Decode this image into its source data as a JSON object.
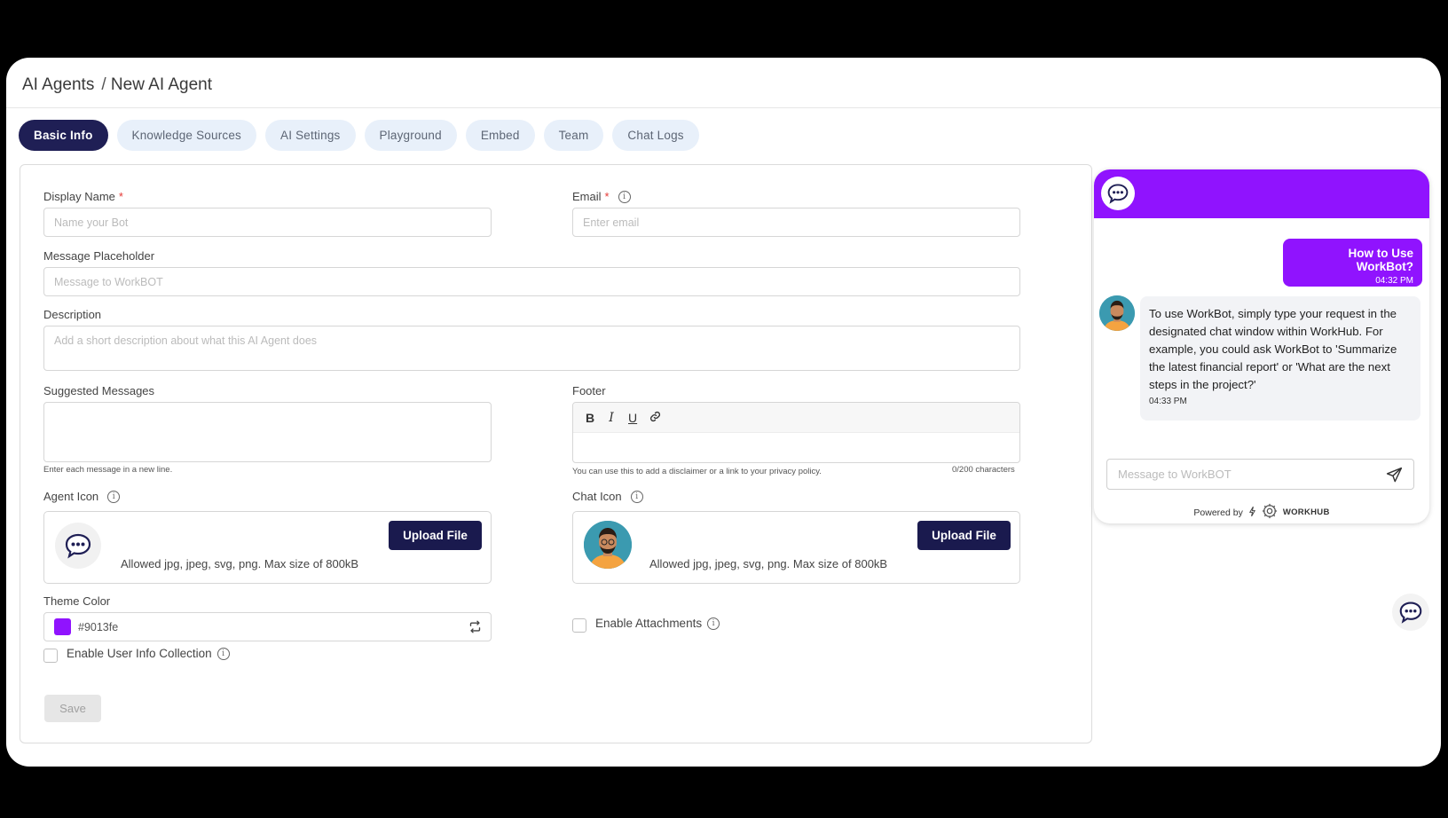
{
  "breadcrumb": {
    "root": "AI Agents",
    "separator": "/",
    "current": "New AI Agent"
  },
  "tabs": [
    {
      "label": "Basic Info",
      "active": true
    },
    {
      "label": "Knowledge Sources"
    },
    {
      "label": "AI Settings"
    },
    {
      "label": "Playground"
    },
    {
      "label": "Embed"
    },
    {
      "label": "Team"
    },
    {
      "label": "Chat Logs"
    }
  ],
  "form": {
    "display_name": {
      "label": "Display Name",
      "required": "*",
      "placeholder": "Name your Bot"
    },
    "email": {
      "label": "Email",
      "required": "*",
      "placeholder": "Enter email"
    },
    "message_placeholder": {
      "label": "Message Placeholder",
      "placeholder": "Message to WorkBOT"
    },
    "description": {
      "label": "Description",
      "placeholder": "Add a short description about what this AI Agent does"
    },
    "suggested_messages": {
      "label": "Suggested Messages",
      "hint": "Enter each message in a new line."
    },
    "footer": {
      "label": "Footer",
      "toolbar": [
        "B",
        "I",
        "U"
      ],
      "hint": "You can use this to add a disclaimer or a link to your privacy policy.",
      "counter": "0/200 characters"
    },
    "agent_icon": {
      "label": "Agent Icon",
      "button": "Upload File",
      "hint": "Allowed jpg, jpeg, svg, png. Max size of 800kB"
    },
    "chat_icon": {
      "label": "Chat Icon",
      "button": "Upload File",
      "hint": "Allowed jpg, jpeg, svg, png. Max size of 800kB"
    },
    "theme_color": {
      "label": "Theme Color",
      "value": "#9013fe"
    },
    "enable_user_info": {
      "label": "Enable User Info Collection",
      "checked": false
    },
    "enable_attachments": {
      "label": "Enable Attachments",
      "checked": false
    },
    "save_label": "Save"
  },
  "preview": {
    "user_message": "How to Use WorkBot?",
    "user_time": "04:32 PM",
    "bot_message": "To use WorkBot, simply type your request in the designated chat window within WorkHub. For example, you could ask WorkBot to 'Summarize the latest financial report' or 'What are the next steps in the project?'",
    "bot_time": "04:33 PM",
    "input_placeholder": "Message to WorkBOT",
    "powered_by": "Powered by",
    "brand": "WORKHUB"
  },
  "colors": {
    "theme": "#9013fe",
    "nav_active": "#1f1f55",
    "button": "#1a1a4e"
  }
}
